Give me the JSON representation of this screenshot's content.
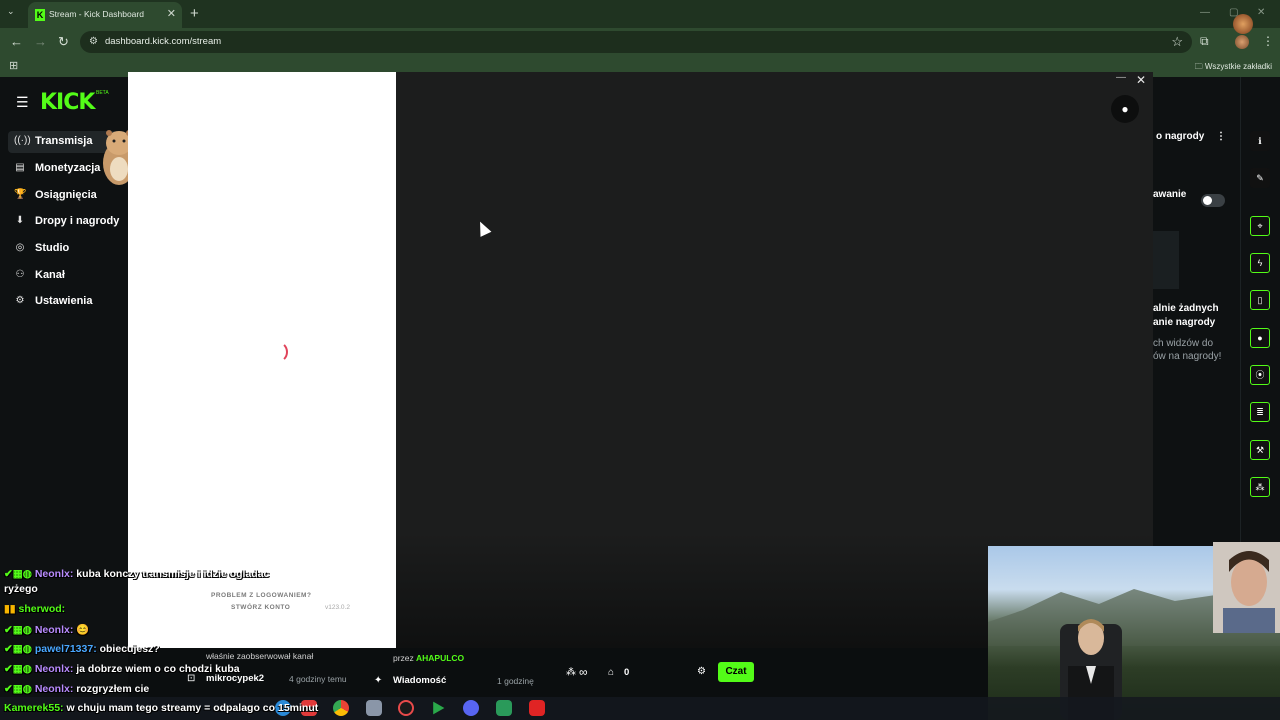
{
  "browser": {
    "tab_title": "Stream - Kick Dashboard",
    "url": "dashboard.kick.com/stream",
    "bookmarks_all": "Wszystkie zakładki"
  },
  "sidebar": {
    "logo": "KICK",
    "logo_badge": "BETA",
    "items": [
      {
        "label": "Transmisja",
        "icon": "broadcast-icon"
      },
      {
        "label": "Monetyzacja",
        "icon": "chart-icon"
      },
      {
        "label": "Osiągnięcia",
        "icon": "trophy-icon"
      },
      {
        "label": "Dropy i nagrody",
        "icon": "drops-icon"
      },
      {
        "label": "Studio",
        "icon": "studio-icon"
      },
      {
        "label": "Kanał",
        "icon": "channel-icon"
      },
      {
        "label": "Ustawienia",
        "icon": "gear-icon"
      }
    ]
  },
  "modal": {
    "login_problem": "PROBLEM Z LOGOWANIEM?",
    "create_account": "STWÓRZ KONTO",
    "version": "v123.0.2"
  },
  "right_panel": {
    "rewards_title": "o nagrody",
    "toggle_label": "awanie",
    "empty_title_1": "alnie żadnych",
    "empty_title_2": "anie nagrody",
    "empty_desc_1": "ch widzów do",
    "empty_desc_2": "ów na nagrody!"
  },
  "activity": {
    "followed_text": "właśnie zaobserwował kanał",
    "follower_name": "mikrocypek2",
    "follower_time": "4 godziny temu",
    "by_label": "przez",
    "by_name": "AHAPULCO",
    "message_label": "Wiadomość",
    "message_time": "1 godzinę"
  },
  "chat_controls": {
    "viewers": "∞",
    "count": "0",
    "send_label": "Czat"
  },
  "stream_chat": [
    {
      "user": "Neonlx:",
      "text": "kuba konczy transmisje i idzie ogladac"
    },
    {
      "user": "",
      "text": "ryżego"
    },
    {
      "user": "sherwod:",
      "text": ""
    },
    {
      "user": "Neonlx:",
      "text": "😊"
    },
    {
      "user": "pawel71337:",
      "text": "obiecujesz?"
    },
    {
      "user": "Neonlx:",
      "text": "ja dobrze wiem o co chodzi kuba"
    },
    {
      "user": "Neonlx:",
      "text": "rozgryzłem cie"
    },
    {
      "user": "Kamerek55:",
      "text": "w chuju mam tego streamy = odpalago co 15minut"
    }
  ],
  "colors": {
    "accent": "#53fc18",
    "background": "#0b0e0f",
    "modal": "#1c1d1d",
    "spinner": "#e0435a"
  }
}
